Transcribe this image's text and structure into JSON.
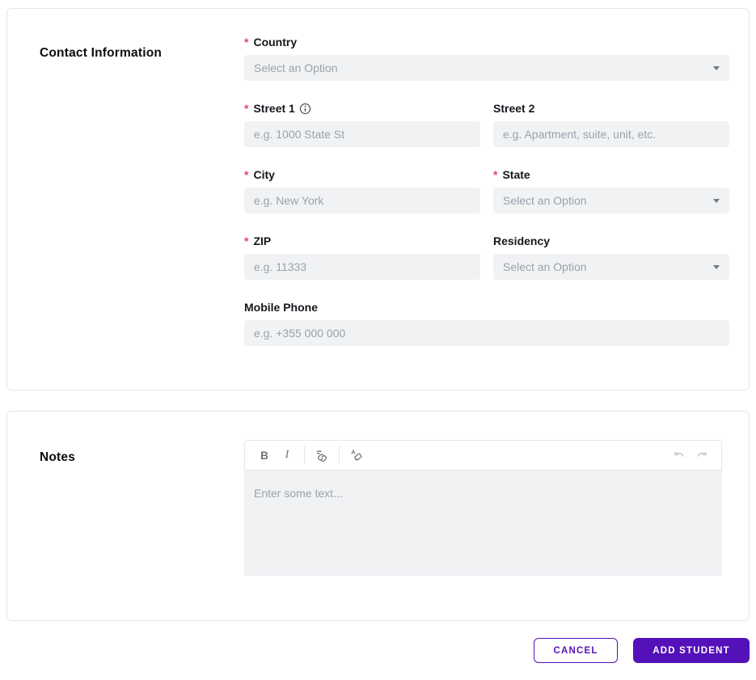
{
  "colors": {
    "accent_purple": "#5511b9",
    "required_marker_color": "#e8426d",
    "input_background": "#f1f2f4",
    "card_border": "#e4e6ea"
  },
  "required_marker": "*",
  "contact": {
    "title": "Contact Information",
    "country": {
      "label": "Country",
      "placeholder": "Select an Option"
    },
    "street1": {
      "label": "Street 1",
      "placeholder": "e.g. 1000 State St"
    },
    "street2": {
      "label": "Street 2",
      "placeholder": "e.g. Apartment, suite, unit, etc."
    },
    "city": {
      "label": "City",
      "placeholder": "e.g. New York"
    },
    "state": {
      "label": "State",
      "placeholder": "Select an Option"
    },
    "zip": {
      "label": "ZIP",
      "placeholder": "e.g. 11333"
    },
    "residency": {
      "label": "Residency",
      "placeholder": "Select an Option"
    },
    "mobile": {
      "label": "Mobile Phone",
      "placeholder": "e.g. +355 000 000"
    }
  },
  "notes": {
    "title": "Notes",
    "editor": {
      "placeholder": "Enter some text...",
      "toolbar": {
        "bold": "B",
        "italic": "I"
      }
    }
  },
  "footer": {
    "cancel": "CANCEL",
    "add_student": "ADD STUDENT"
  }
}
